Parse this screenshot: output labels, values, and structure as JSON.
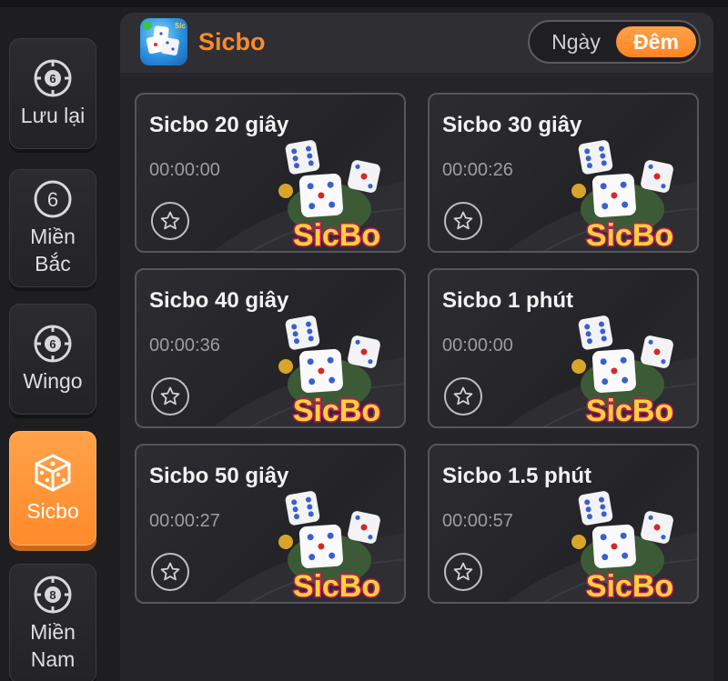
{
  "sidebar": {
    "items": [
      {
        "label": "Lưu lại",
        "icon": "lottery-ball-6-icon",
        "ball": "6"
      },
      {
        "label": "Miền Bắc",
        "icon": "number-6-circle-icon",
        "ball": "6"
      },
      {
        "label": "Wingo",
        "icon": "lottery-ball-6-icon",
        "ball": "6"
      },
      {
        "label": "Sicbo",
        "icon": "dice-icon",
        "active": true
      },
      {
        "label": "Miền Nam",
        "icon": "lottery-ball-8-icon",
        "ball": "8"
      }
    ]
  },
  "header": {
    "logo": "sicbo-app-logo",
    "title": "Sicbo",
    "mode_toggle": {
      "day": "Ngày",
      "night": "Đêm",
      "selected": "Đêm"
    }
  },
  "games": [
    {
      "name": "Sicbo 20 giây",
      "countdown": "00:00:00"
    },
    {
      "name": "Sicbo 30 giây",
      "countdown": "00:00:26"
    },
    {
      "name": "Sicbo 40 giây",
      "countdown": "00:00:36"
    },
    {
      "name": "Sicbo 1 phút",
      "countdown": "00:00:00"
    },
    {
      "name": "Sicbo 50 giây",
      "countdown": "00:00:27"
    },
    {
      "name": "Sicbo 1.5 phút",
      "countdown": "00:00:57"
    }
  ],
  "art_label": "SicBo",
  "colors": {
    "accent": "#ff8a2a",
    "background": "#1e1e21",
    "card_border": "#55555b"
  }
}
